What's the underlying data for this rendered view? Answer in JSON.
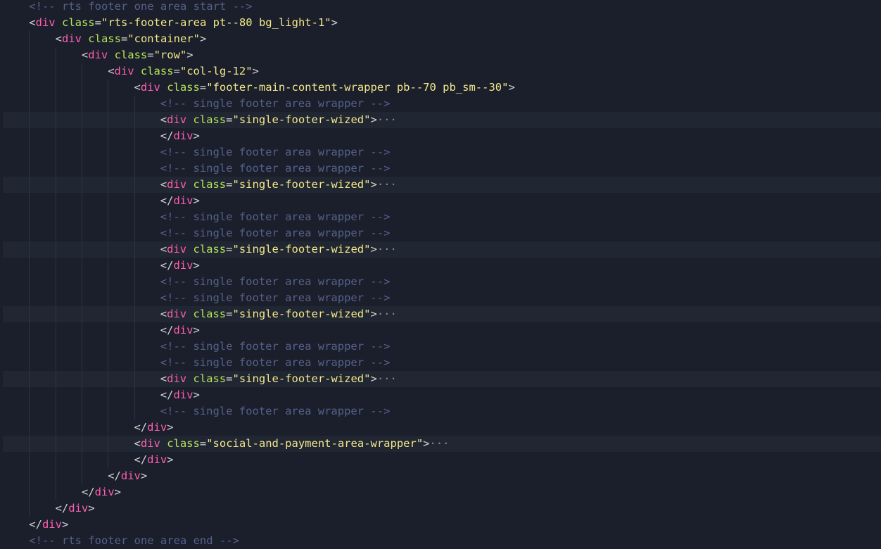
{
  "editor": {
    "language": "html",
    "theme_colors": {
      "background": "#1a1f2b",
      "folded_line_background": "#212633",
      "tag": "#ff5faf",
      "attribute": "#b6e35b",
      "string": "#f3e88a",
      "comment": "#56618a",
      "punctuation": "#d4d4d4",
      "indent_guide": "#2e3443"
    },
    "fold_marker": "···",
    "lines": [
      {
        "indent": 1,
        "tokens": [
          {
            "t": "cmt",
            "v": "<!-- rts footer one area start -->"
          }
        ]
      },
      {
        "indent": 1,
        "tokens": [
          {
            "t": "punc",
            "v": "<"
          },
          {
            "t": "tag",
            "v": "div"
          },
          {
            "t": "punc",
            "v": " "
          },
          {
            "t": "attr",
            "v": "class"
          },
          {
            "t": "eq",
            "v": "="
          },
          {
            "t": "str",
            "v": "\"rts-footer-area pt--80 bg_light-1\""
          },
          {
            "t": "punc",
            "v": ">"
          }
        ]
      },
      {
        "indent": 2,
        "tokens": [
          {
            "t": "punc",
            "v": "<"
          },
          {
            "t": "tag",
            "v": "div"
          },
          {
            "t": "punc",
            "v": " "
          },
          {
            "t": "attr",
            "v": "class"
          },
          {
            "t": "eq",
            "v": "="
          },
          {
            "t": "str",
            "v": "\"container\""
          },
          {
            "t": "punc",
            "v": ">"
          }
        ]
      },
      {
        "indent": 3,
        "tokens": [
          {
            "t": "punc",
            "v": "<"
          },
          {
            "t": "tag",
            "v": "div"
          },
          {
            "t": "punc",
            "v": " "
          },
          {
            "t": "attr",
            "v": "class"
          },
          {
            "t": "eq",
            "v": "="
          },
          {
            "t": "str",
            "v": "\"row\""
          },
          {
            "t": "punc",
            "v": ">"
          }
        ]
      },
      {
        "indent": 4,
        "tokens": [
          {
            "t": "punc",
            "v": "<"
          },
          {
            "t": "tag",
            "v": "div"
          },
          {
            "t": "punc",
            "v": " "
          },
          {
            "t": "attr",
            "v": "class"
          },
          {
            "t": "eq",
            "v": "="
          },
          {
            "t": "str",
            "v": "\"col-lg-12\""
          },
          {
            "t": "punc",
            "v": ">"
          }
        ]
      },
      {
        "indent": 5,
        "tokens": [
          {
            "t": "punc",
            "v": "<"
          },
          {
            "t": "tag",
            "v": "div"
          },
          {
            "t": "punc",
            "v": " "
          },
          {
            "t": "attr",
            "v": "class"
          },
          {
            "t": "eq",
            "v": "="
          },
          {
            "t": "str",
            "v": "\"footer-main-content-wrapper pb--70 pb_sm--30\""
          },
          {
            "t": "punc",
            "v": ">"
          }
        ]
      },
      {
        "indent": 6,
        "tokens": [
          {
            "t": "cmt",
            "v": "<!-- single footer area wrapper -->"
          }
        ]
      },
      {
        "indent": 6,
        "folded": true,
        "tokens": [
          {
            "t": "punc",
            "v": "<"
          },
          {
            "t": "tag",
            "v": "div"
          },
          {
            "t": "punc",
            "v": " "
          },
          {
            "t": "attr",
            "v": "class"
          },
          {
            "t": "eq",
            "v": "="
          },
          {
            "t": "str",
            "v": "\"single-footer-wized\""
          },
          {
            "t": "punc",
            "v": ">"
          }
        ]
      },
      {
        "indent": 6,
        "tokens": [
          {
            "t": "punc",
            "v": "</"
          },
          {
            "t": "tag",
            "v": "div"
          },
          {
            "t": "punc",
            "v": ">"
          }
        ]
      },
      {
        "indent": 6,
        "tokens": [
          {
            "t": "cmt",
            "v": "<!-- single footer area wrapper -->"
          }
        ]
      },
      {
        "indent": 6,
        "tokens": [
          {
            "t": "cmt",
            "v": "<!-- single footer area wrapper -->"
          }
        ]
      },
      {
        "indent": 6,
        "folded": true,
        "tokens": [
          {
            "t": "punc",
            "v": "<"
          },
          {
            "t": "tag",
            "v": "div"
          },
          {
            "t": "punc",
            "v": " "
          },
          {
            "t": "attr",
            "v": "class"
          },
          {
            "t": "eq",
            "v": "="
          },
          {
            "t": "str",
            "v": "\"single-footer-wized\""
          },
          {
            "t": "punc",
            "v": ">"
          }
        ]
      },
      {
        "indent": 6,
        "tokens": [
          {
            "t": "punc",
            "v": "</"
          },
          {
            "t": "tag",
            "v": "div"
          },
          {
            "t": "punc",
            "v": ">"
          }
        ]
      },
      {
        "indent": 6,
        "tokens": [
          {
            "t": "cmt",
            "v": "<!-- single footer area wrapper -->"
          }
        ]
      },
      {
        "indent": 6,
        "tokens": [
          {
            "t": "cmt",
            "v": "<!-- single footer area wrapper -->"
          }
        ]
      },
      {
        "indent": 6,
        "folded": true,
        "tokens": [
          {
            "t": "punc",
            "v": "<"
          },
          {
            "t": "tag",
            "v": "div"
          },
          {
            "t": "punc",
            "v": " "
          },
          {
            "t": "attr",
            "v": "class"
          },
          {
            "t": "eq",
            "v": "="
          },
          {
            "t": "str",
            "v": "\"single-footer-wized\""
          },
          {
            "t": "punc",
            "v": ">"
          }
        ]
      },
      {
        "indent": 6,
        "tokens": [
          {
            "t": "punc",
            "v": "</"
          },
          {
            "t": "tag",
            "v": "div"
          },
          {
            "t": "punc",
            "v": ">"
          }
        ]
      },
      {
        "indent": 6,
        "tokens": [
          {
            "t": "cmt",
            "v": "<!-- single footer area wrapper -->"
          }
        ]
      },
      {
        "indent": 6,
        "tokens": [
          {
            "t": "cmt",
            "v": "<!-- single footer area wrapper -->"
          }
        ]
      },
      {
        "indent": 6,
        "folded": true,
        "tokens": [
          {
            "t": "punc",
            "v": "<"
          },
          {
            "t": "tag",
            "v": "div"
          },
          {
            "t": "punc",
            "v": " "
          },
          {
            "t": "attr",
            "v": "class"
          },
          {
            "t": "eq",
            "v": "="
          },
          {
            "t": "str",
            "v": "\"single-footer-wized\""
          },
          {
            "t": "punc",
            "v": ">"
          }
        ]
      },
      {
        "indent": 6,
        "tokens": [
          {
            "t": "punc",
            "v": "</"
          },
          {
            "t": "tag",
            "v": "div"
          },
          {
            "t": "punc",
            "v": ">"
          }
        ]
      },
      {
        "indent": 6,
        "tokens": [
          {
            "t": "cmt",
            "v": "<!-- single footer area wrapper -->"
          }
        ]
      },
      {
        "indent": 6,
        "tokens": [
          {
            "t": "cmt",
            "v": "<!-- single footer area wrapper -->"
          }
        ]
      },
      {
        "indent": 6,
        "folded": true,
        "tokens": [
          {
            "t": "punc",
            "v": "<"
          },
          {
            "t": "tag",
            "v": "div"
          },
          {
            "t": "punc",
            "v": " "
          },
          {
            "t": "attr",
            "v": "class"
          },
          {
            "t": "eq",
            "v": "="
          },
          {
            "t": "str",
            "v": "\"single-footer-wized\""
          },
          {
            "t": "punc",
            "v": ">"
          }
        ]
      },
      {
        "indent": 6,
        "tokens": [
          {
            "t": "punc",
            "v": "</"
          },
          {
            "t": "tag",
            "v": "div"
          },
          {
            "t": "punc",
            "v": ">"
          }
        ]
      },
      {
        "indent": 6,
        "tokens": [
          {
            "t": "cmt",
            "v": "<!-- single footer area wrapper -->"
          }
        ]
      },
      {
        "indent": 5,
        "tokens": [
          {
            "t": "punc",
            "v": "</"
          },
          {
            "t": "tag",
            "v": "div"
          },
          {
            "t": "punc",
            "v": ">"
          }
        ]
      },
      {
        "indent": 5,
        "folded": true,
        "tokens": [
          {
            "t": "punc",
            "v": "<"
          },
          {
            "t": "tag",
            "v": "div"
          },
          {
            "t": "punc",
            "v": " "
          },
          {
            "t": "attr",
            "v": "class"
          },
          {
            "t": "eq",
            "v": "="
          },
          {
            "t": "str",
            "v": "\"social-and-payment-area-wrapper\""
          },
          {
            "t": "punc",
            "v": ">"
          }
        ]
      },
      {
        "indent": 5,
        "tokens": [
          {
            "t": "punc",
            "v": "</"
          },
          {
            "t": "tag",
            "v": "div"
          },
          {
            "t": "punc",
            "v": ">"
          }
        ]
      },
      {
        "indent": 4,
        "tokens": [
          {
            "t": "punc",
            "v": "</"
          },
          {
            "t": "tag",
            "v": "div"
          },
          {
            "t": "punc",
            "v": ">"
          }
        ]
      },
      {
        "indent": 3,
        "tokens": [
          {
            "t": "punc",
            "v": "</"
          },
          {
            "t": "tag",
            "v": "div"
          },
          {
            "t": "punc",
            "v": ">"
          }
        ]
      },
      {
        "indent": 2,
        "tokens": [
          {
            "t": "punc",
            "v": "</"
          },
          {
            "t": "tag",
            "v": "div"
          },
          {
            "t": "punc",
            "v": ">"
          }
        ]
      },
      {
        "indent": 1,
        "tokens": [
          {
            "t": "punc",
            "v": "</"
          },
          {
            "t": "tag",
            "v": "div"
          },
          {
            "t": "punc",
            "v": ">"
          }
        ]
      },
      {
        "indent": 1,
        "tokens": [
          {
            "t": "cmt",
            "v": "<!-- rts footer one area end -->"
          }
        ]
      }
    ]
  }
}
